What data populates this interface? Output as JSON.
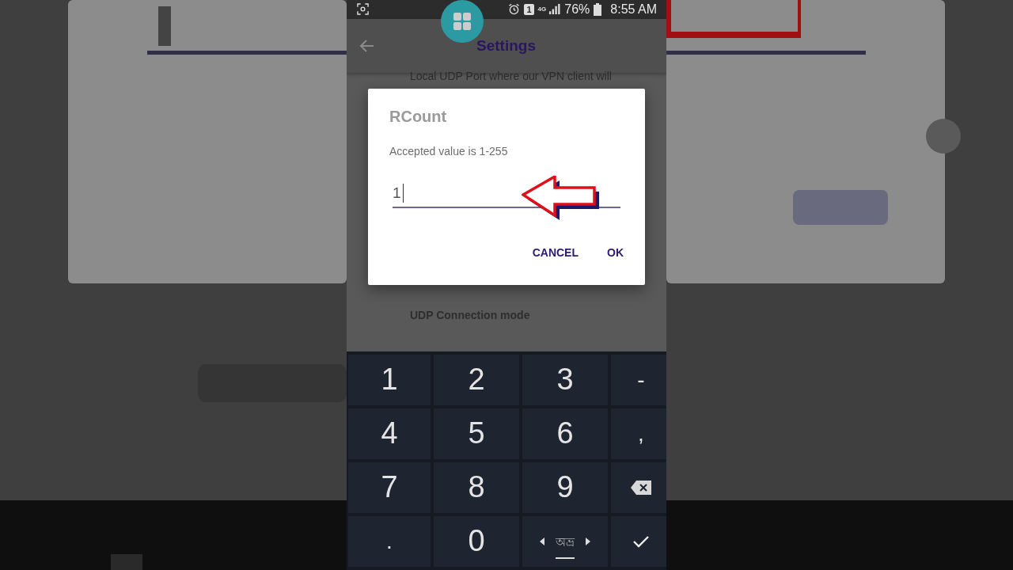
{
  "status_bar": {
    "sim_slot": "1",
    "network": "4G",
    "battery": "76%",
    "time": "8:55 AM"
  },
  "app_bar": {
    "title": "Settings"
  },
  "settings": [
    {
      "kind": "summary",
      "text": "Local UDP Port where our VPN client will"
    },
    {
      "kind": "title",
      "text": "UDP Connection mode"
    }
  ],
  "dialog": {
    "title": "RCount",
    "message": "Accepted value is 1-255",
    "value": "1",
    "buttons": [
      "CANCEL",
      "OK"
    ]
  },
  "keyboard": {
    "rows": [
      [
        {
          "kind": "char",
          "label": "1"
        },
        {
          "kind": "char",
          "label": "2"
        },
        {
          "kind": "char",
          "label": "3"
        },
        {
          "kind": "symbol",
          "label": "-"
        }
      ],
      [
        {
          "kind": "char",
          "label": "4"
        },
        {
          "kind": "char",
          "label": "5"
        },
        {
          "kind": "char",
          "label": "6"
        },
        {
          "kind": "symbol",
          "label": ","
        }
      ],
      [
        {
          "kind": "char",
          "label": "7"
        },
        {
          "kind": "char",
          "label": "8"
        },
        {
          "kind": "char",
          "label": "9"
        },
        {
          "kind": "backspace"
        }
      ],
      [
        {
          "kind": "symbol",
          "label": "."
        },
        {
          "kind": "char",
          "label": "0"
        },
        {
          "kind": "language",
          "label": "অভ্র"
        },
        {
          "kind": "done"
        }
      ]
    ]
  }
}
